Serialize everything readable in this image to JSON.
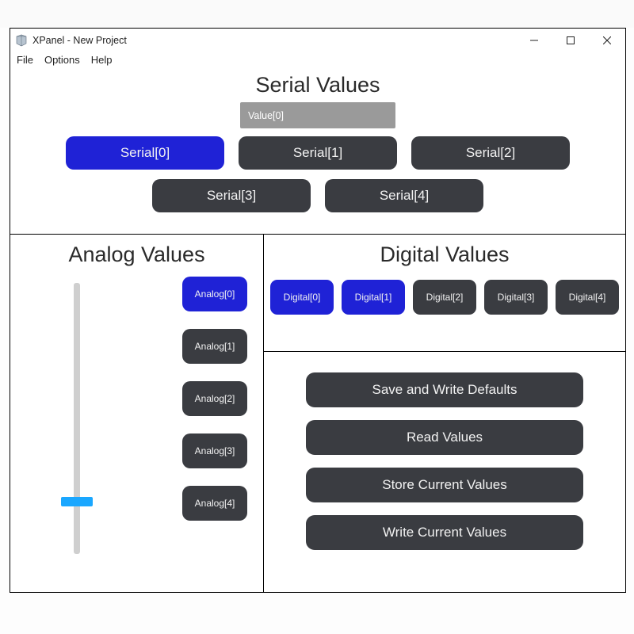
{
  "window": {
    "title": "XPanel - New Project"
  },
  "menu": {
    "file": "File",
    "options": "Options",
    "help": "Help"
  },
  "serial": {
    "title": "Serial Values",
    "value_placeholder": "Value[0]",
    "buttons": [
      {
        "label": "Serial[0]",
        "active": true
      },
      {
        "label": "Serial[1]",
        "active": false
      },
      {
        "label": "Serial[2]",
        "active": false
      },
      {
        "label": "Serial[3]",
        "active": false
      },
      {
        "label": "Serial[4]",
        "active": false
      }
    ]
  },
  "analog": {
    "title": "Analog Values",
    "buttons": [
      {
        "label": "Analog[0]",
        "active": true
      },
      {
        "label": "Analog[1]",
        "active": false
      },
      {
        "label": "Analog[2]",
        "active": false
      },
      {
        "label": "Analog[3]",
        "active": false
      },
      {
        "label": "Analog[4]",
        "active": false
      }
    ]
  },
  "digital": {
    "title": "Digital Values",
    "buttons": [
      {
        "label": "Digital[0]",
        "active": true
      },
      {
        "label": "Digital[1]",
        "active": true
      },
      {
        "label": "Digital[2]",
        "active": false
      },
      {
        "label": "Digital[3]",
        "active": false
      },
      {
        "label": "Digital[4]",
        "active": false
      }
    ]
  },
  "actions": {
    "save_defaults": "Save and Write Defaults",
    "read_values": "Read Values",
    "store_current": "Store Current Values",
    "write_current": "Write Current Values"
  }
}
